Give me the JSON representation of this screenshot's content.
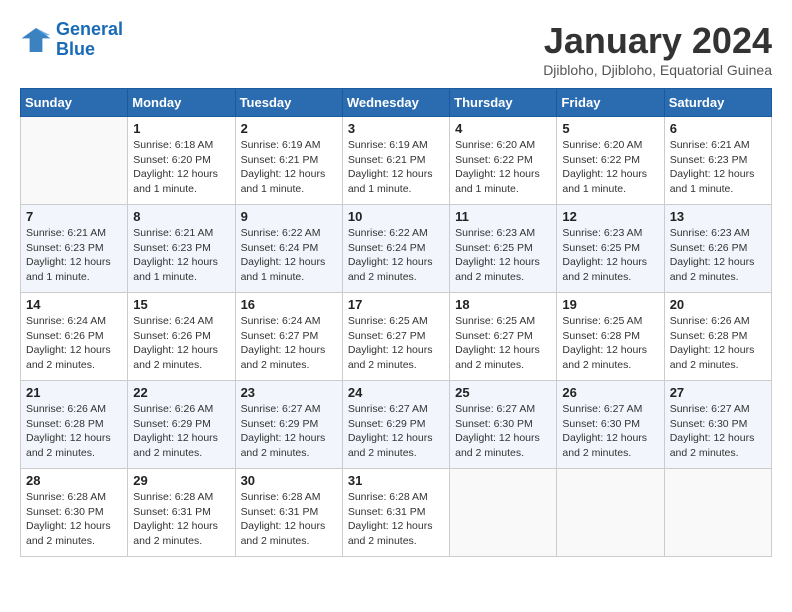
{
  "logo": {
    "line1": "General",
    "line2": "Blue"
  },
  "title": "January 2024",
  "subtitle": "Djibloho, Djibloho, Equatorial Guinea",
  "weekdays": [
    "Sunday",
    "Monday",
    "Tuesday",
    "Wednesday",
    "Thursday",
    "Friday",
    "Saturday"
  ],
  "weeks": [
    [
      {
        "day": "",
        "info": ""
      },
      {
        "day": "1",
        "info": "Sunrise: 6:18 AM\nSunset: 6:20 PM\nDaylight: 12 hours\nand 1 minute."
      },
      {
        "day": "2",
        "info": "Sunrise: 6:19 AM\nSunset: 6:21 PM\nDaylight: 12 hours\nand 1 minute."
      },
      {
        "day": "3",
        "info": "Sunrise: 6:19 AM\nSunset: 6:21 PM\nDaylight: 12 hours\nand 1 minute."
      },
      {
        "day": "4",
        "info": "Sunrise: 6:20 AM\nSunset: 6:22 PM\nDaylight: 12 hours\nand 1 minute."
      },
      {
        "day": "5",
        "info": "Sunrise: 6:20 AM\nSunset: 6:22 PM\nDaylight: 12 hours\nand 1 minute."
      },
      {
        "day": "6",
        "info": "Sunrise: 6:21 AM\nSunset: 6:23 PM\nDaylight: 12 hours\nand 1 minute."
      }
    ],
    [
      {
        "day": "7",
        "info": "Sunrise: 6:21 AM\nSunset: 6:23 PM\nDaylight: 12 hours\nand 1 minute."
      },
      {
        "day": "8",
        "info": "Sunrise: 6:21 AM\nSunset: 6:23 PM\nDaylight: 12 hours\nand 1 minute."
      },
      {
        "day": "9",
        "info": "Sunrise: 6:22 AM\nSunset: 6:24 PM\nDaylight: 12 hours\nand 1 minute."
      },
      {
        "day": "10",
        "info": "Sunrise: 6:22 AM\nSunset: 6:24 PM\nDaylight: 12 hours\nand 2 minutes."
      },
      {
        "day": "11",
        "info": "Sunrise: 6:23 AM\nSunset: 6:25 PM\nDaylight: 12 hours\nand 2 minutes."
      },
      {
        "day": "12",
        "info": "Sunrise: 6:23 AM\nSunset: 6:25 PM\nDaylight: 12 hours\nand 2 minutes."
      },
      {
        "day": "13",
        "info": "Sunrise: 6:23 AM\nSunset: 6:26 PM\nDaylight: 12 hours\nand 2 minutes."
      }
    ],
    [
      {
        "day": "14",
        "info": "Sunrise: 6:24 AM\nSunset: 6:26 PM\nDaylight: 12 hours\nand 2 minutes."
      },
      {
        "day": "15",
        "info": "Sunrise: 6:24 AM\nSunset: 6:26 PM\nDaylight: 12 hours\nand 2 minutes."
      },
      {
        "day": "16",
        "info": "Sunrise: 6:24 AM\nSunset: 6:27 PM\nDaylight: 12 hours\nand 2 minutes."
      },
      {
        "day": "17",
        "info": "Sunrise: 6:25 AM\nSunset: 6:27 PM\nDaylight: 12 hours\nand 2 minutes."
      },
      {
        "day": "18",
        "info": "Sunrise: 6:25 AM\nSunset: 6:27 PM\nDaylight: 12 hours\nand 2 minutes."
      },
      {
        "day": "19",
        "info": "Sunrise: 6:25 AM\nSunset: 6:28 PM\nDaylight: 12 hours\nand 2 minutes."
      },
      {
        "day": "20",
        "info": "Sunrise: 6:26 AM\nSunset: 6:28 PM\nDaylight: 12 hours\nand 2 minutes."
      }
    ],
    [
      {
        "day": "21",
        "info": "Sunrise: 6:26 AM\nSunset: 6:28 PM\nDaylight: 12 hours\nand 2 minutes."
      },
      {
        "day": "22",
        "info": "Sunrise: 6:26 AM\nSunset: 6:29 PM\nDaylight: 12 hours\nand 2 minutes."
      },
      {
        "day": "23",
        "info": "Sunrise: 6:27 AM\nSunset: 6:29 PM\nDaylight: 12 hours\nand 2 minutes."
      },
      {
        "day": "24",
        "info": "Sunrise: 6:27 AM\nSunset: 6:29 PM\nDaylight: 12 hours\nand 2 minutes."
      },
      {
        "day": "25",
        "info": "Sunrise: 6:27 AM\nSunset: 6:30 PM\nDaylight: 12 hours\nand 2 minutes."
      },
      {
        "day": "26",
        "info": "Sunrise: 6:27 AM\nSunset: 6:30 PM\nDaylight: 12 hours\nand 2 minutes."
      },
      {
        "day": "27",
        "info": "Sunrise: 6:27 AM\nSunset: 6:30 PM\nDaylight: 12 hours\nand 2 minutes."
      }
    ],
    [
      {
        "day": "28",
        "info": "Sunrise: 6:28 AM\nSunset: 6:30 PM\nDaylight: 12 hours\nand 2 minutes."
      },
      {
        "day": "29",
        "info": "Sunrise: 6:28 AM\nSunset: 6:31 PM\nDaylight: 12 hours\nand 2 minutes."
      },
      {
        "day": "30",
        "info": "Sunrise: 6:28 AM\nSunset: 6:31 PM\nDaylight: 12 hours\nand 2 minutes."
      },
      {
        "day": "31",
        "info": "Sunrise: 6:28 AM\nSunset: 6:31 PM\nDaylight: 12 hours\nand 2 minutes."
      },
      {
        "day": "",
        "info": ""
      },
      {
        "day": "",
        "info": ""
      },
      {
        "day": "",
        "info": ""
      }
    ]
  ]
}
